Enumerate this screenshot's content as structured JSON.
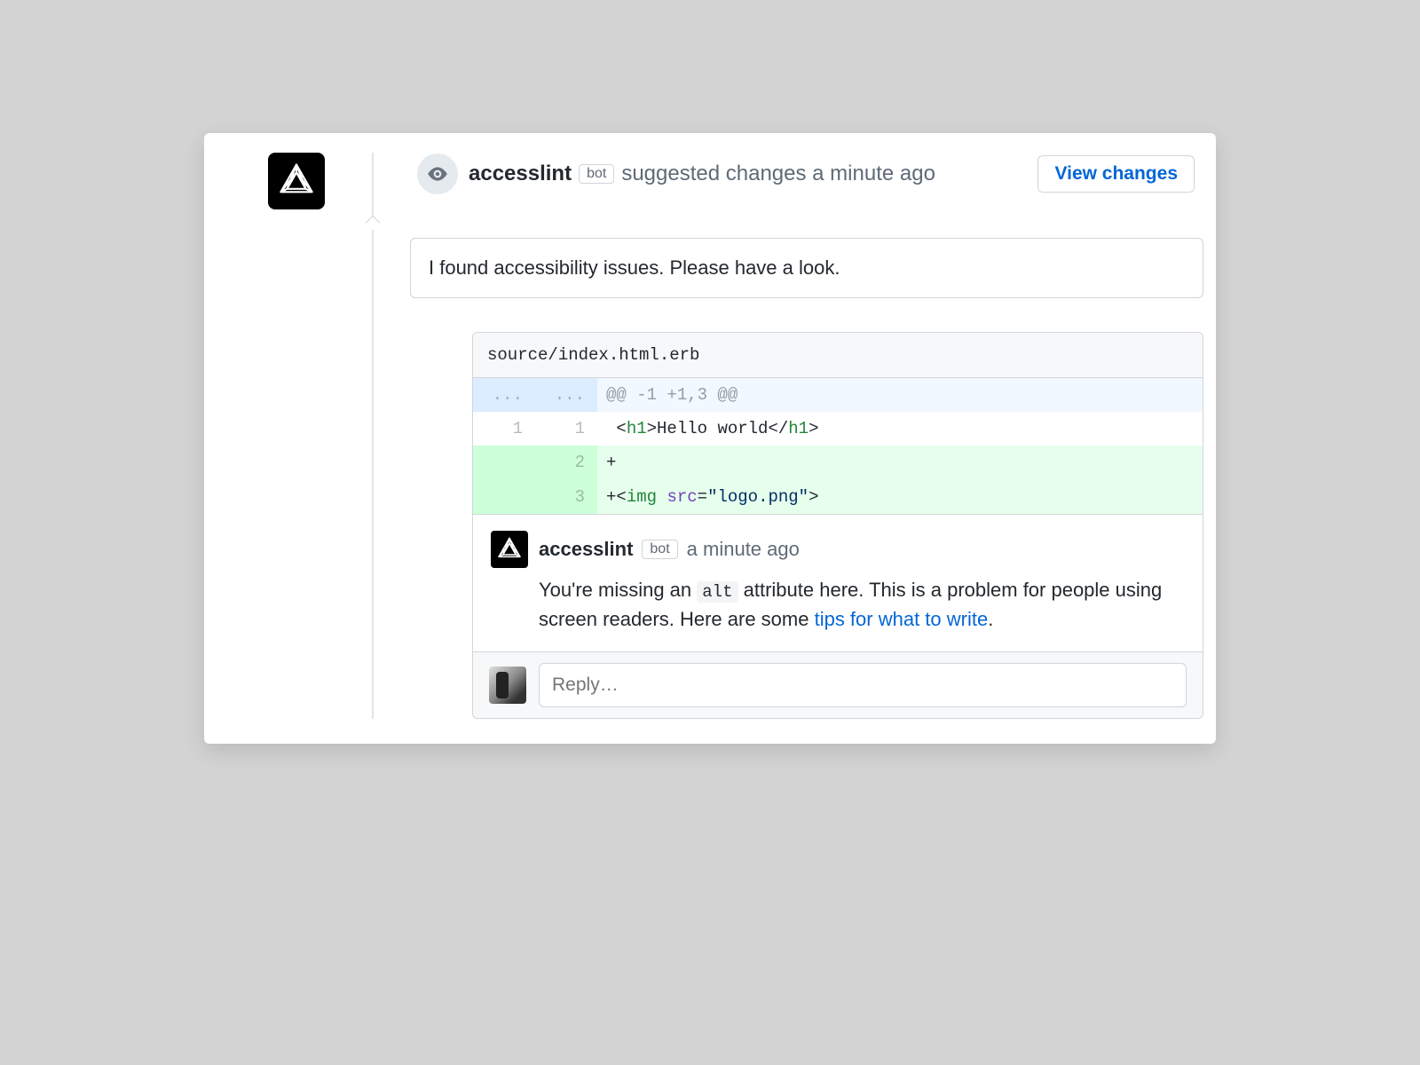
{
  "header": {
    "author": "accesslint",
    "bot_label": "bot",
    "action": "suggested changes a minute ago",
    "button": "View changes"
  },
  "summary": "I found accessibility issues. Please have a look.",
  "diff": {
    "file": "source/index.html.erb",
    "hunk": "@@ -1 +1,3 @@",
    "hunk_marker": "...",
    "lines": [
      {
        "old": "1",
        "new": "1",
        "type": "ctx"
      },
      {
        "old": "",
        "new": "2",
        "type": "add",
        "prefix": "+"
      },
      {
        "old": "",
        "new": "3",
        "type": "add",
        "prefix": "+"
      }
    ]
  },
  "comment": {
    "author": "accesslint",
    "bot_label": "bot",
    "time": "a minute ago",
    "pre": "You're missing an ",
    "code": "alt",
    "mid": " attribute here. This is a problem for people using screen readers. Here are some ",
    "link": "tips for what to write",
    "post": "."
  },
  "reply": {
    "placeholder": "Reply…"
  }
}
